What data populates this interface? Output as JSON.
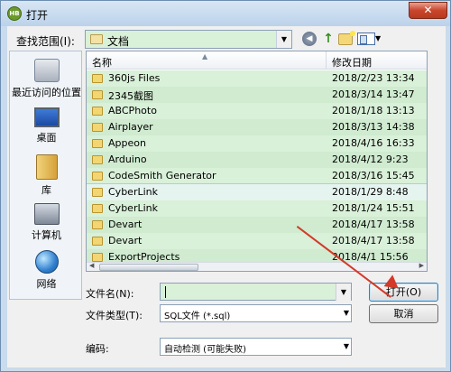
{
  "window": {
    "title": "打开",
    "close_symbol": "✕"
  },
  "lookin": {
    "label": "查找范围(I):",
    "value": "文档"
  },
  "places": [
    {
      "label": "最近访问的位置",
      "icon": "recent-places-icon"
    },
    {
      "label": "桌面",
      "icon": "desktop-icon"
    },
    {
      "label": "库",
      "icon": "library-icon"
    },
    {
      "label": "计算机",
      "icon": "computer-icon"
    },
    {
      "label": "网络",
      "icon": "network-icon"
    }
  ],
  "list": {
    "col_name": "名称",
    "col_date": "修改日期",
    "rows": [
      {
        "name": "360js Files",
        "date": "2018/2/23 13:34"
      },
      {
        "name": "2345截图",
        "date": "2018/3/14 13:47"
      },
      {
        "name": "ABCPhoto",
        "date": "2018/1/18 13:13"
      },
      {
        "name": "Airplayer",
        "date": "2018/3/13 14:38"
      },
      {
        "name": "Appeon",
        "date": "2018/4/16 16:33"
      },
      {
        "name": "Arduino",
        "date": "2018/4/12 9:23"
      },
      {
        "name": "CodeSmith Generator",
        "date": "2018/3/16 15:45"
      },
      {
        "name": "CyberLink",
        "date": "2018/1/29 8:48"
      },
      {
        "name": "CyberLink",
        "date": "2018/1/24 15:51"
      },
      {
        "name": "Devart",
        "date": "2018/4/17 13:58"
      },
      {
        "name": "Devart",
        "date": "2018/4/17 13:58"
      },
      {
        "name": "ExportProjects",
        "date": "2018/4/1 15:56"
      }
    ]
  },
  "filename": {
    "label": "文件名(N):",
    "value": ""
  },
  "filetype": {
    "label": "文件类型(T):",
    "value": "SQL文件 (*.sql)"
  },
  "encoding": {
    "label": "编码:",
    "value": "自动检测 (可能失败)"
  },
  "buttons": {
    "open": "打开(O)",
    "cancel": "取消"
  },
  "colors": {
    "highlight": "#d9f0d9",
    "arrow": "#d23a2a"
  }
}
